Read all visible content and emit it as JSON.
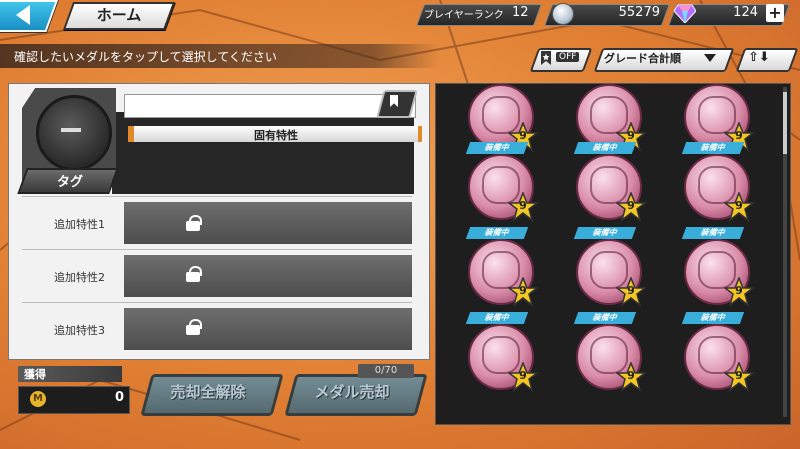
{
  "header": {
    "back_icon": "back-arrow-icon",
    "home_label": "ホーム",
    "player_rank_label": "プレイヤーランク",
    "player_rank_value": "12",
    "coin_value": "55279",
    "gem_value": "124",
    "plus_label": "+"
  },
  "instruction": "確認したいメダルをタップして選択してください",
  "controls": {
    "favorite_filter": "OFF",
    "sort_label": "グレード合計順",
    "sort_order_icons": "⇧⬇"
  },
  "detail": {
    "unique_trait_label": "固有特性",
    "tag_label": "タグ",
    "sub_traits": [
      "追加特性1",
      "追加特性2",
      "追加特性3"
    ]
  },
  "acquire": {
    "label": "獲得",
    "currency_icon": "M",
    "value": "0"
  },
  "actions": {
    "release_all_label": "売却全解除",
    "sell_medal_label": "メダル売却",
    "sell_counter": "0/70"
  },
  "medal_grid": {
    "equipped_label": "装備中",
    "rows": [
      [
        {
          "grade": "9",
          "equipped": false
        },
        {
          "grade": "9",
          "equipped": false
        },
        {
          "grade": "9",
          "equipped": false
        }
      ],
      [
        {
          "grade": "9",
          "equipped": true
        },
        {
          "grade": "9",
          "equipped": true
        },
        {
          "grade": "9",
          "equipped": true
        }
      ],
      [
        {
          "grade": "9",
          "equipped": true
        },
        {
          "grade": "9",
          "equipped": true
        },
        {
          "grade": "9",
          "equipped": true
        }
      ],
      [
        {
          "grade": "9",
          "equipped": true
        },
        {
          "grade": "9",
          "equipped": true
        },
        {
          "grade": "9",
          "equipped": true
        }
      ]
    ]
  },
  "colors": {
    "accent_blue": "#3aaeda",
    "background_orange": "#e48a3d",
    "medal_pink": "#d88aa7",
    "star_gold": "#f3c623"
  }
}
